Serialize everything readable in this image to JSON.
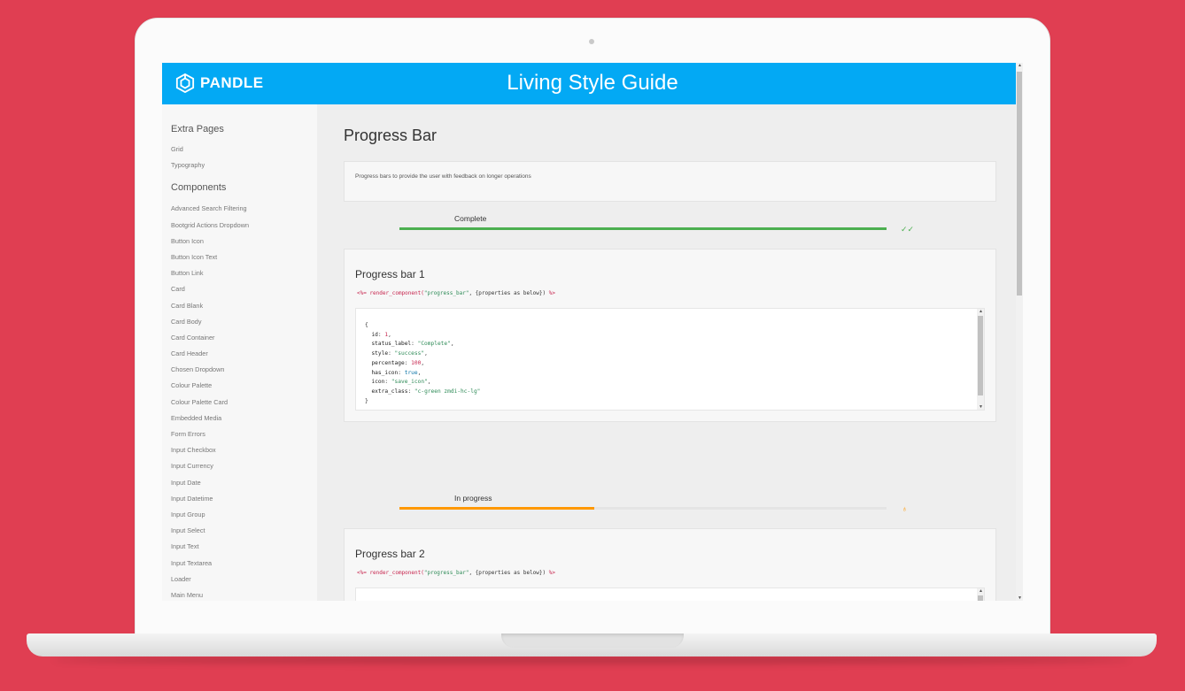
{
  "app": {
    "brand": "PANDLE",
    "title": "Living Style Guide"
  },
  "sidebar": {
    "sections": [
      {
        "heading": "Extra Pages",
        "items": [
          "Grid",
          "Typography"
        ]
      },
      {
        "heading": "Components",
        "items": [
          "Advanced Search Filtering",
          "Bootgrid Actions Dropdown",
          "Button Icon",
          "Button Icon Text",
          "Button Link",
          "Card",
          "Card Blank",
          "Card Body",
          "Card Container",
          "Card Header",
          "Chosen Dropdown",
          "Colour Palette",
          "Colour Palette Card",
          "Embedded Media",
          "Form Errors",
          "Input Checkbox",
          "Input Currency",
          "Input Date",
          "Input Datetime",
          "Input Group",
          "Input Select",
          "Input Text",
          "Input Textarea",
          "Loader",
          "Main Menu"
        ]
      }
    ]
  },
  "main": {
    "page_title": "Progress Bar",
    "description": "Progress bars to provide the user with feedback on longer operations",
    "progress_bars": [
      {
        "label": "Complete",
        "percentage": 100,
        "color": "#4caf50",
        "icon": "check-double-icon"
      },
      {
        "label": "In progress",
        "percentage": 40,
        "color": "#ff9800",
        "icon": "lightbulb-icon"
      }
    ],
    "cards": [
      {
        "title": "Progress bar 1",
        "call_open": "<%= render_component(",
        "call_name": "\"progress_bar\"",
        "call_mid": ", {properties as below}) ",
        "call_close": "%>",
        "code": {
          "id": "1",
          "status_label": "\"Complete\"",
          "style": "\"success\"",
          "percentage": "100",
          "has_icon": "true",
          "icon": "\"save_icon\"",
          "extra_class": "\"c-green zmdi-hc-lg\""
        }
      },
      {
        "title": "Progress bar 2",
        "call_open": "<%= render_component(",
        "call_name": "\"progress_bar\"",
        "call_mid": ", {properties as below}) ",
        "call_close": "%>"
      }
    ]
  },
  "colors": {
    "background": "#e03e52",
    "header": "#03a9f4"
  }
}
